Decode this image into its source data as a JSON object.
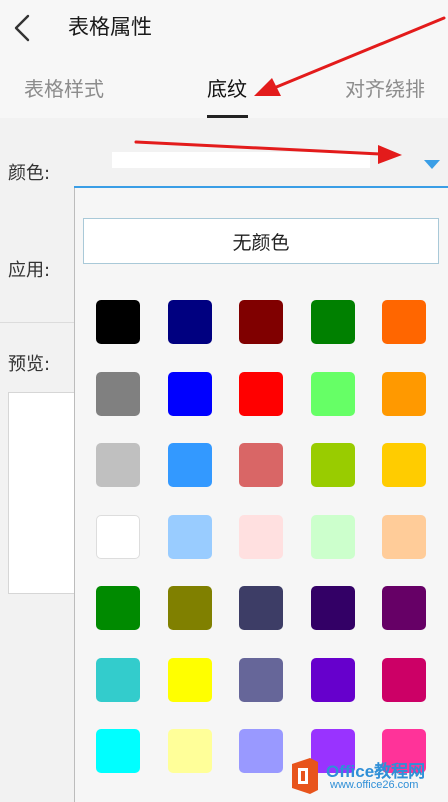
{
  "header": {
    "title": "表格属性",
    "tabs": [
      {
        "label": "表格样式",
        "active": false
      },
      {
        "label": "底纹",
        "active": true
      },
      {
        "label": "对齐绕排",
        "active": false
      }
    ]
  },
  "form": {
    "color_label": "颜色:",
    "apply_label": "应用:",
    "preview_label": "预览:"
  },
  "popup": {
    "no_color_label": "无颜色",
    "swatches": [
      "#000000",
      "#000080",
      "#800000",
      "#008000",
      "#ff6600",
      "#808080",
      "#0000ff",
      "#ff0000",
      "#66ff66",
      "#ff9900",
      "#c0c0c0",
      "#3399ff",
      "#d96666",
      "#99cc00",
      "#ffcc00",
      "#ffffff",
      "#99ccff",
      "#ffe0e0",
      "#ccffcc",
      "#ffcc99",
      "#008a00",
      "#808000",
      "#3d3d66",
      "#330066",
      "#660066",
      "#33cccc",
      "#ffff00",
      "#666699",
      "#6600cc",
      "#cc0066",
      "#00ffff",
      "#ffff99",
      "#9999ff",
      "#9933ff",
      "#ff3399"
    ]
  },
  "colors": {
    "accent_line": "#3a9ee6",
    "arrow": "#e31b1b"
  },
  "watermark": {
    "brand": "Office教程网",
    "url": "www.office26.com"
  }
}
